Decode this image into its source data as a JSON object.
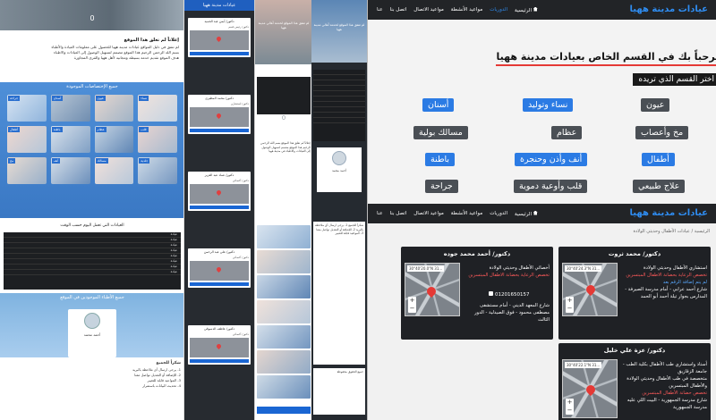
{
  "panelA": {
    "hero_number": "0",
    "intro_title": "إعلاناً لم تعلق هذا الموقع",
    "intro_lines": [
      "لم تتفق في دليل المواقع عيادات مدينة ههيا للحصول على معلومات العيادة والأطباء",
      "بسم الله الرحمن الرحيم هذا الموقع مصمم لتسهيل الوصول إلى العيادات والاطباء",
      "هدف الموقع تقديم خدمة بسيطة ومجانية لأهل ههيا والقرى المجاورة"
    ],
    "specialties_title": "جميع الإختصاصات الموجودة",
    "tiles": [
      "جراحة",
      "أسنان",
      "عيون",
      "نساء",
      "أطفال",
      "باطنة",
      "عظام",
      "قلب",
      "مخ",
      "أنف",
      "مسالك",
      "جلدية"
    ],
    "table_title": "العيادات التي تعمل اليوم حسب الوقت",
    "table_rows": [
      "عيادة",
      "عيادة",
      "عيادة",
      "عيادة",
      "عيادة",
      "عيادة",
      "عيادة",
      "عيادة"
    ],
    "docs_title": "جميع الأطباء الموجودين في الموقع",
    "doc_name": "أحمد محمد",
    "notes_title": "شكراً للجميع",
    "notes_lines": [
      "1- يرجى ارسال أي ملاحظة بالبريد",
      "2- للإضافة أو التعديل تواصل معنا",
      "3- المواعيد قابلة للتغيير",
      "4- تحديث البيانات باستمرار"
    ]
  },
  "panelB": {
    "bar_title": "عيادات مدينة ههيا",
    "cards": [
      {
        "title": "دكتور/ أيمن عبد الحميد",
        "lines": [
          "دكتور/ رئيس قسم",
          "العيادة"
        ]
      },
      {
        "title": "دكتور/ محمد المطيرى",
        "lines": [
          "دكتور/ استشاري",
          "العيادة"
        ]
      },
      {
        "title": "دكتور/ عماد عبد العزيز",
        "lines": [
          "دكتور/ أخصائي",
          "العيادة"
        ]
      },
      {
        "title": "دكتور/ علي عبد الرحمن",
        "lines": [
          "دكتور/ أخصائي",
          "العيادة"
        ]
      },
      {
        "title": "دكتور/ عاطف الدسوقي",
        "lines": [
          "دكتور/ أخصائي",
          "العيادة"
        ]
      }
    ]
  },
  "panelC": {
    "hero_text": "لم تتفق هذا الموقع لخدمة أهالي مدينة ههيا",
    "counter": "0",
    "body_text": "إعلاناً لم تعلق هذا الموقع بسم الله الرحمن الرحيم هذا الموقع مصمم لتسهيل الوصول إلى العيادات والاطباء في مدينة ههيا"
  },
  "panelD": {
    "hero_text": "لم تتفق هذا الموقع لخدمة أهالي مدينة ههيا",
    "doc_name": "أحمد محمد",
    "body_text": "شكراً للجميع 1- يرجى ارسال أي ملاحظة بالبريد 2- للإضافة أو التعديل تواصل معنا 3- المواعيد قابلة للتغيير",
    "footer_text": "جميع الحقوق محفوظة"
  },
  "main": {
    "brand": "عيادات مدينة ههيا",
    "nav": [
      "الرئيسية",
      "الدوريات",
      "مواعيد الأنشطة",
      "مواعيد الاتصال",
      "اتصل بنا",
      "عنا"
    ],
    "active_nav": "الدوريات",
    "welcome": "مرحباً بك في القسم الخاص بعيادات مدينة ههيا",
    "chooser": "اختر القسم الذي تريده",
    "specialties": [
      {
        "label": "عيون",
        "style": "grey"
      },
      {
        "label": "نساء وتوليد",
        "style": "blue"
      },
      {
        "label": "أسنان",
        "style": "blue"
      },
      {
        "label": "مخ وأعصاب",
        "style": "grey"
      },
      {
        "label": "عظام",
        "style": "grey"
      },
      {
        "label": "مسالك بولية",
        "style": "grey"
      },
      {
        "label": "أطفال",
        "style": "blue"
      },
      {
        "label": "أنف وأذن وحنجرة",
        "style": "blue"
      },
      {
        "label": "باطنة",
        "style": "blue"
      },
      {
        "label": "علاج طبيعي",
        "style": "grey"
      },
      {
        "label": "قلب وأوعية دموية",
        "style": "grey"
      },
      {
        "label": "جراحة",
        "style": "grey"
      }
    ],
    "breadcrumb": "الرئيسية / عيادات الأطفال وحديثي الولادة",
    "cards": [
      {
        "title": "دكتور/ محمد ثروت",
        "desc_lines": [
          "استشاري الأطفال وحديثي الولادة",
          "المدينة"
        ],
        "highlight": "تخصص الرعاية بحضانة الاطفال المبتسرين",
        "link": "لم يتم إضافة الرقم بعد",
        "address": "شارع أحمد عرابي - أمام مدرسة الصيرفة - المدارس بجوار تيلة أحمد أبو الحمد",
        "coord": "30°40'24.3\"N 31..."
      },
      {
        "title": "دكتور/ أحمد محمد جوده",
        "desc_lines": [
          "أخصائي الأطفال وحديثي الولادة"
        ],
        "highlight": "تخصص الرعاية بحضانة الاطفال المبتسرين",
        "phone": "01201650157",
        "address": "شارع المعهد الديني - أمام مستشفى مصطفى محمود - فوق الصيدلية - الدور الثالث",
        "coord": "30°40'20.0\"N 31..."
      },
      {
        "title": "دكتور/ عزة علي خليل",
        "desc_lines": [
          "أستاذ واستشاري طب الأطفال بكلية الطب - جامعة الزقازيق",
          "متخصصة في طب الأطفال وحديثي الولادة والأطفال المبتسرين"
        ],
        "highlight": "تخصص حضانة الأطفال المبتسرين",
        "address": "شارع مدرسة الجمهورية - البيت اللي عليه مدرسة الجمهورية",
        "coord": "30°40'22.1\"N 31..."
      }
    ]
  }
}
